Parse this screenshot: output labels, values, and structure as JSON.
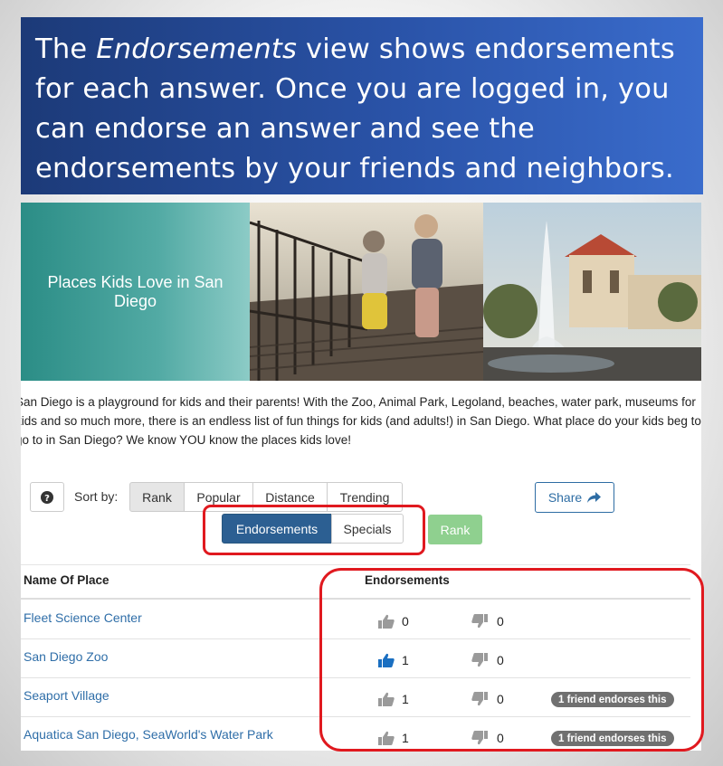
{
  "caption": {
    "before": "The ",
    "emph": "Endorsements",
    "after": " view shows endorsements for each answer. Once you are logged in, you can endorse an answer and see the endorsements by your friends and neighbors."
  },
  "banner": {
    "title": "Places Kids Love in San Diego"
  },
  "intro": "San Diego is a playground for kids and their parents! With the Zoo, Animal Park, Legoland, beaches, water park, museums for kids and so much more, there is an endless list of fun things for kids (and adults!) in San Diego. What place do your kids beg to go to in San Diego? We know YOU know the places kids love!",
  "toolbar": {
    "help_icon": "question-circle-icon",
    "sort_label": "Sort by:",
    "sort_options": [
      "Rank",
      "Popular",
      "Distance",
      "Trending"
    ],
    "active_sort": "Rank",
    "share_label": "Share",
    "view_options": [
      "Endorsements",
      "Specials"
    ],
    "active_view": "Endorsements",
    "rank_button": "Rank"
  },
  "table": {
    "headers": {
      "name": "Name Of Place",
      "endorsements": "Endorsements"
    },
    "rows": [
      {
        "name": "Fleet Science Center",
        "up": "0",
        "down": "0",
        "user_endorsed": false,
        "badge": ""
      },
      {
        "name": "San Diego Zoo",
        "up": "1",
        "down": "0",
        "user_endorsed": true,
        "badge": ""
      },
      {
        "name": "Seaport Village",
        "up": "1",
        "down": "0",
        "user_endorsed": false,
        "badge": "1 friend endorses this"
      },
      {
        "name": "Aquatica San Diego, SeaWorld's Water Park",
        "up": "1",
        "down": "0",
        "user_endorsed": false,
        "badge": "1 friend endorses this"
      }
    ]
  },
  "colors": {
    "caption_bg": "#2a53a8",
    "primary": "#2c5f92",
    "link": "#2f6ea8",
    "rank_green": "#8fd08f",
    "highlight": "#e0191f",
    "thumb_active": "#1a6fc1",
    "thumb_inactive": "#9a9a9a"
  }
}
